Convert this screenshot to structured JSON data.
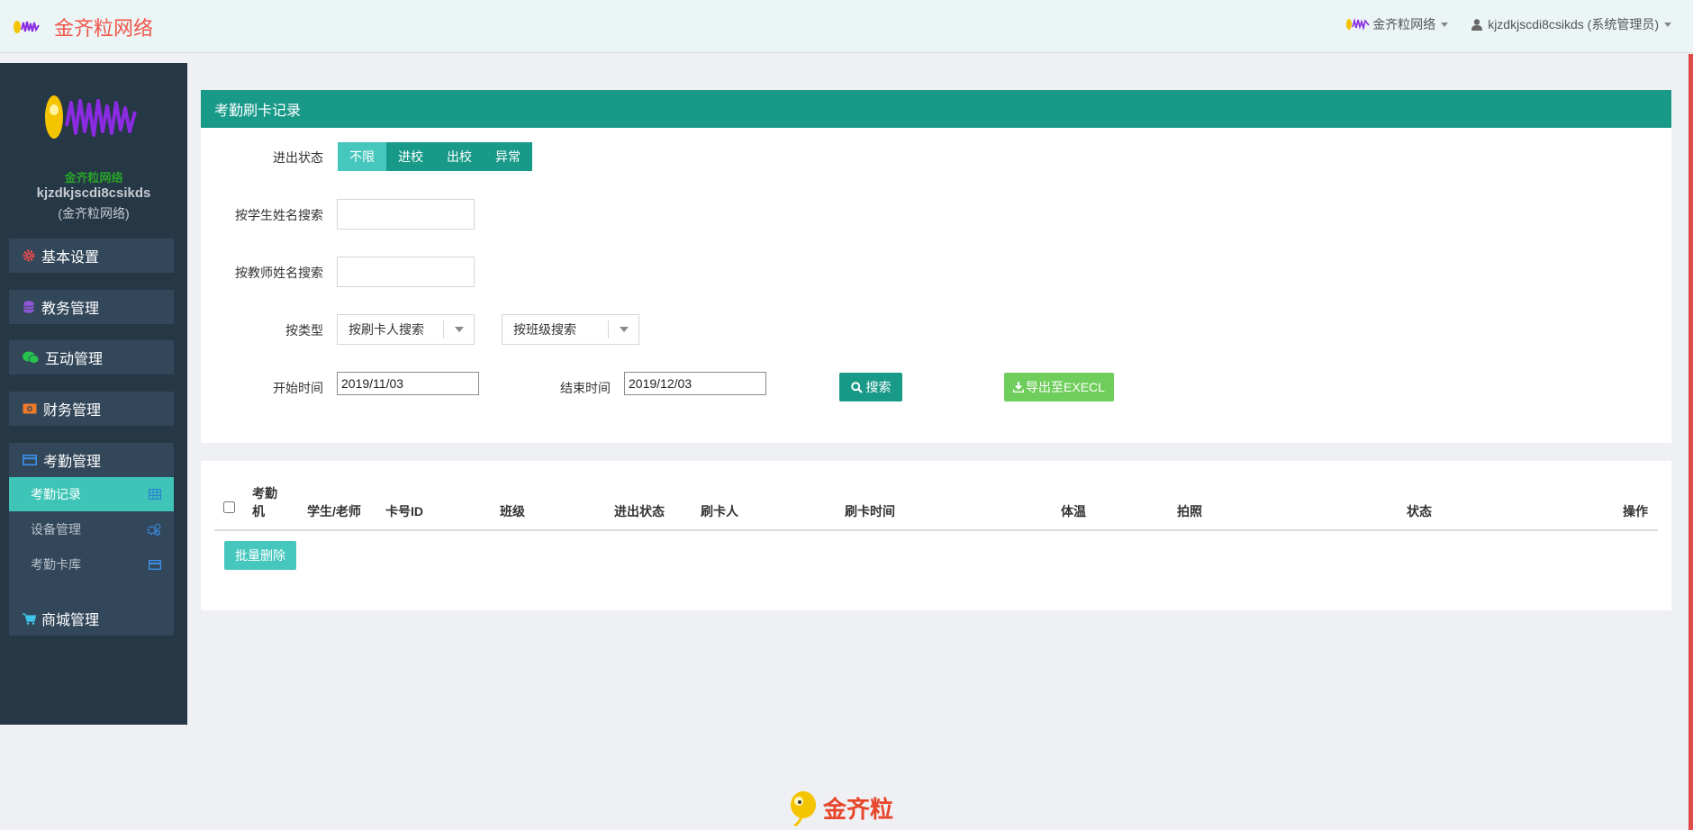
{
  "header": {
    "brand_title": "金齐粒网络",
    "org_menu": "金齐粒网络",
    "user_menu": "kjzdkjscdi8csikds (系统管理员)"
  },
  "sidebar": {
    "org_name": "金齐粒网络",
    "username": "kjzdkjscdi8csikds",
    "org_paren": "(金齐粒网络)",
    "menus": [
      {
        "label": "基本设置",
        "icon": "gear-icon"
      },
      {
        "label": "教务管理",
        "icon": "database-icon"
      },
      {
        "label": "互动管理",
        "icon": "wechat-icon"
      },
      {
        "label": "财务管理",
        "icon": "money-icon"
      },
      {
        "label": "考勤管理",
        "icon": "credit-card-icon"
      },
      {
        "label": "商城管理",
        "icon": "cart-icon"
      }
    ],
    "submenus": [
      {
        "label": "考勤记录",
        "icon": "table-icon"
      },
      {
        "label": "设备管理",
        "icon": "cogs-icon"
      },
      {
        "label": "考勤卡库",
        "icon": "card-icon"
      }
    ]
  },
  "filter_panel": {
    "title": "考勤刷卡记录",
    "status_label": "进出状态",
    "status_options": [
      "不限",
      "进校",
      "出校",
      "异常"
    ],
    "status_selected": "不限",
    "student_label": "按学生姓名搜索",
    "student_value": "",
    "teacher_label": "按教师姓名搜索",
    "teacher_value": "",
    "type_label": "按类型",
    "type_select": "按刷卡人搜索",
    "class_select": "按班级搜索",
    "start_label": "开始时间",
    "start_value": "2019/11/03",
    "end_label": "结束时间",
    "end_value": "2019/12/03",
    "search_button": "搜索",
    "export_button": "导出至EXECL"
  },
  "table": {
    "columns": [
      "考勤\n机",
      "学生/老师",
      "卡号ID",
      "班级",
      "进出状态",
      "刷卡人",
      "刷卡时间",
      "体温",
      "拍照",
      "状态",
      "操作"
    ],
    "batch_delete": "批量删除"
  },
  "footer": {
    "logo_text": "金齐粒"
  },
  "colors": {
    "teal": "#199a89",
    "teal_light": "#46c7bd",
    "green": "#6fcd5b",
    "sidebar_bg": "#263746",
    "brand_red": "#f1564a"
  }
}
